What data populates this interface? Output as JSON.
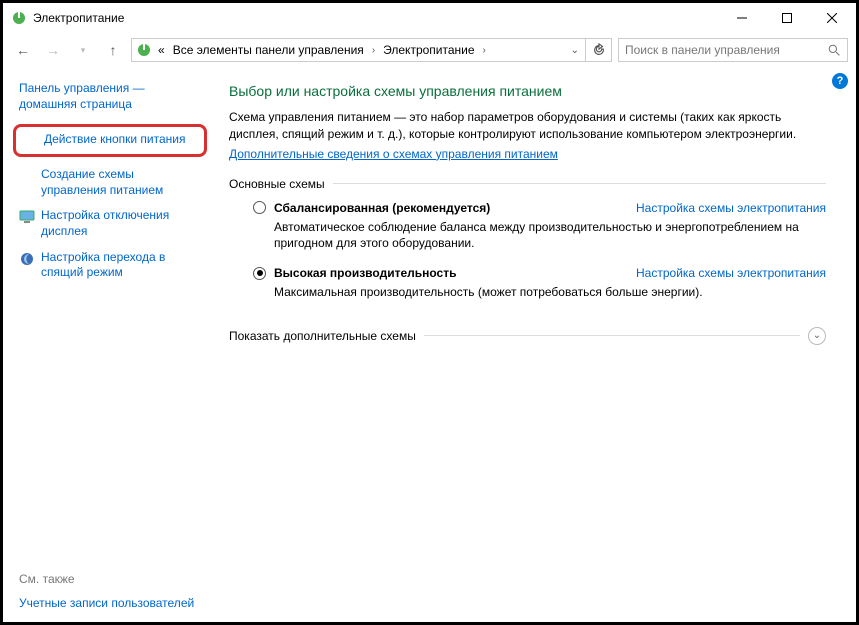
{
  "titlebar": {
    "title": "Электропитание"
  },
  "nav": {
    "path_prefix": "«",
    "seg1": "Все элементы панели управления",
    "seg2": "Электропитание"
  },
  "search": {
    "placeholder": "Поиск в панели управления"
  },
  "sidebar": {
    "home": "Панель управления — домашняя страница",
    "items": [
      "Действие кнопки питания",
      "Создание схемы управления питанием",
      "Настройка отключения дисплея",
      "Настройка перехода в спящий режим"
    ],
    "see_also_label": "См. также",
    "see_also_link": "Учетные записи пользователей"
  },
  "main": {
    "heading": "Выбор или настройка схемы управления питанием",
    "description": "Схема управления питанием — это набор параметров оборудования и системы (таких как яркость дисплея, спящий режим и т. д.), которые контролируют использование компьютером электроэнергии.",
    "more_link": "Дополнительные сведения о схемах управления питанием",
    "section_label": "Основные схемы",
    "plans": [
      {
        "name": "Сбалансированная (рекомендуется)",
        "desc": "Автоматическое соблюдение баланса между производительностью и энергопотреблением на пригодном для этого оборудовании.",
        "settings_link": "Настройка схемы электропитания",
        "selected": false
      },
      {
        "name": "Высокая производительность",
        "desc": "Максимальная производительность (может потребоваться больше энергии).",
        "settings_link": "Настройка схемы электропитания",
        "selected": true
      }
    ],
    "expand_label": "Показать дополнительные схемы"
  }
}
